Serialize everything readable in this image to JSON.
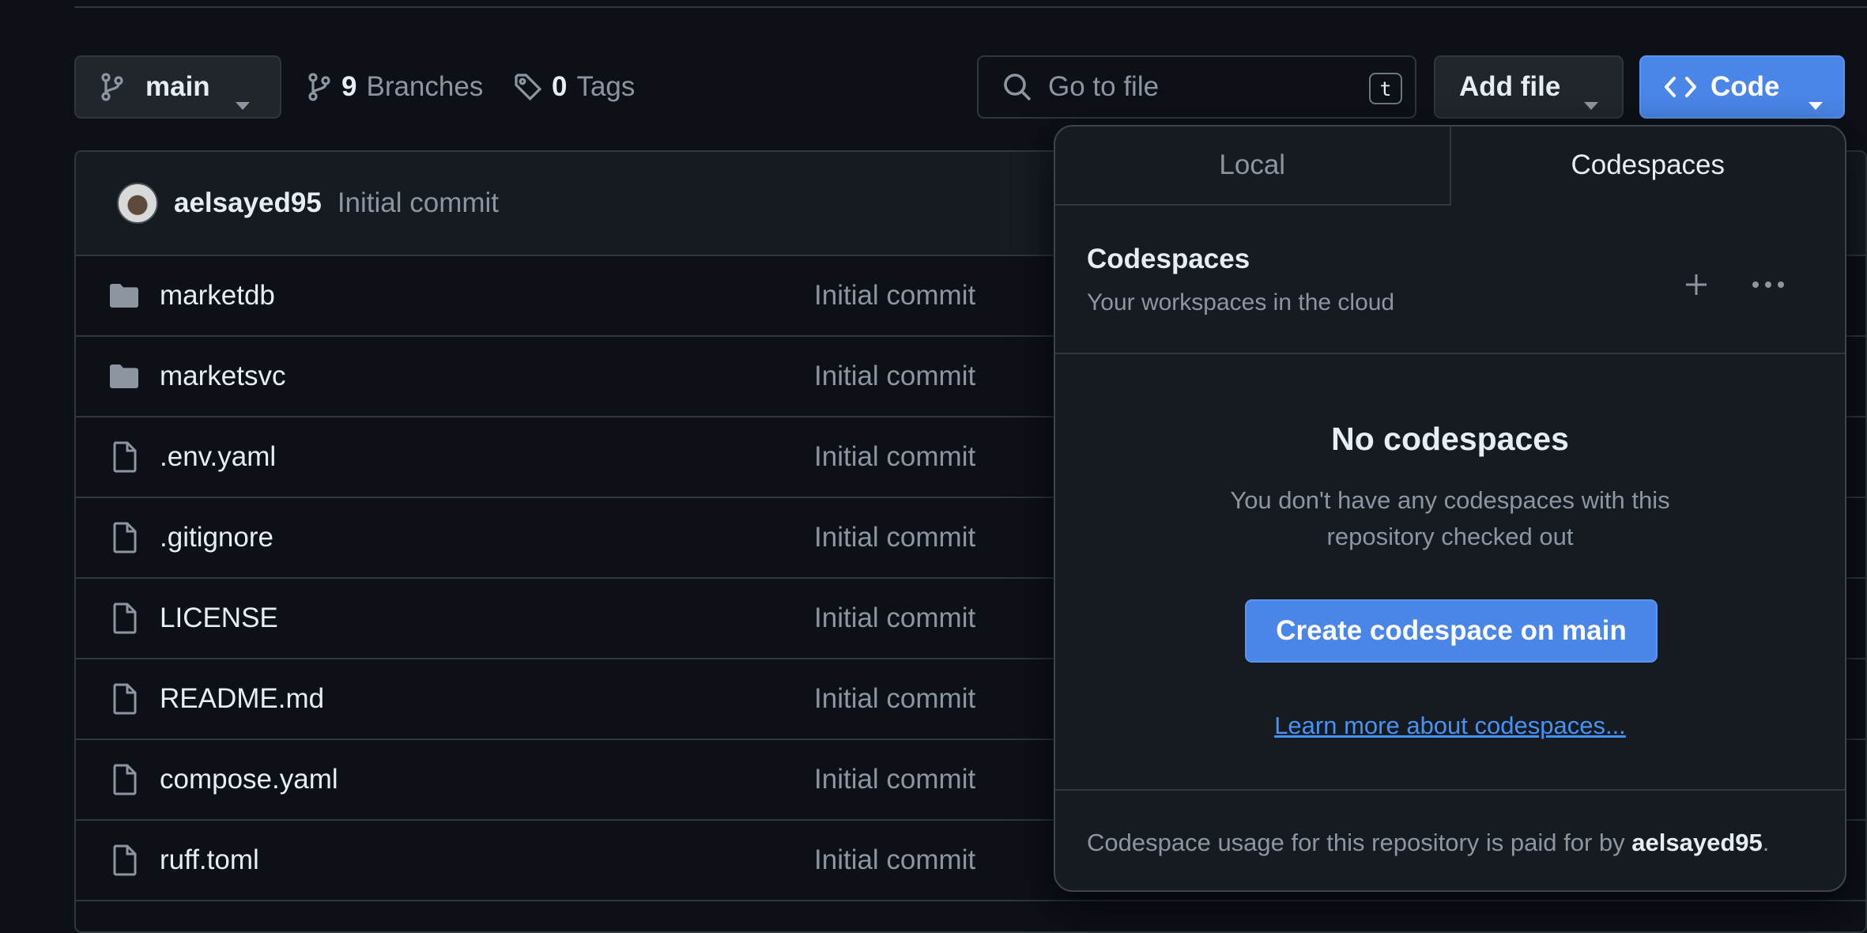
{
  "toolbar": {
    "branch_name": "main",
    "branches_count": "9",
    "branches_label": "Branches",
    "tags_count": "0",
    "tags_label": "Tags",
    "search_placeholder": "Go to file",
    "search_shortcut": "t",
    "add_file_label": "Add file",
    "code_label": "Code"
  },
  "commit": {
    "author": "aelsayed95",
    "message": "Initial commit"
  },
  "files": [
    {
      "name": "marketdb",
      "type": "folder",
      "message": "Initial commit"
    },
    {
      "name": "marketsvc",
      "type": "folder",
      "message": "Initial commit"
    },
    {
      "name": ".env.yaml",
      "type": "file",
      "message": "Initial commit"
    },
    {
      "name": ".gitignore",
      "type": "file",
      "message": "Initial commit"
    },
    {
      "name": "LICENSE",
      "type": "file",
      "message": "Initial commit"
    },
    {
      "name": "README.md",
      "type": "file",
      "message": "Initial commit"
    },
    {
      "name": "compose.yaml",
      "type": "file",
      "message": "Initial commit"
    },
    {
      "name": "ruff.toml",
      "type": "file",
      "message": "Initial commit"
    }
  ],
  "popover": {
    "tabs": [
      {
        "label": "Local",
        "active": false
      },
      {
        "label": "Codespaces",
        "active": true
      }
    ],
    "header_title": "Codespaces",
    "header_subtitle": "Your workspaces in the cloud",
    "empty_title": "No codespaces",
    "empty_description": "You don't have any codespaces with this repository checked out",
    "create_button": "Create codespace on main",
    "learn_more": "Learn more about codespaces...",
    "footer_prefix": "Codespace usage for this repository is paid for by",
    "footer_owner": "aelsayed95",
    "footer_suffix": "."
  },
  "colors": {
    "background": "#0d1117",
    "panel": "#161b22",
    "border": "#30363d",
    "primary_button": "#4a86e8",
    "link": "#4493f8",
    "muted_text": "#8d96a0"
  }
}
